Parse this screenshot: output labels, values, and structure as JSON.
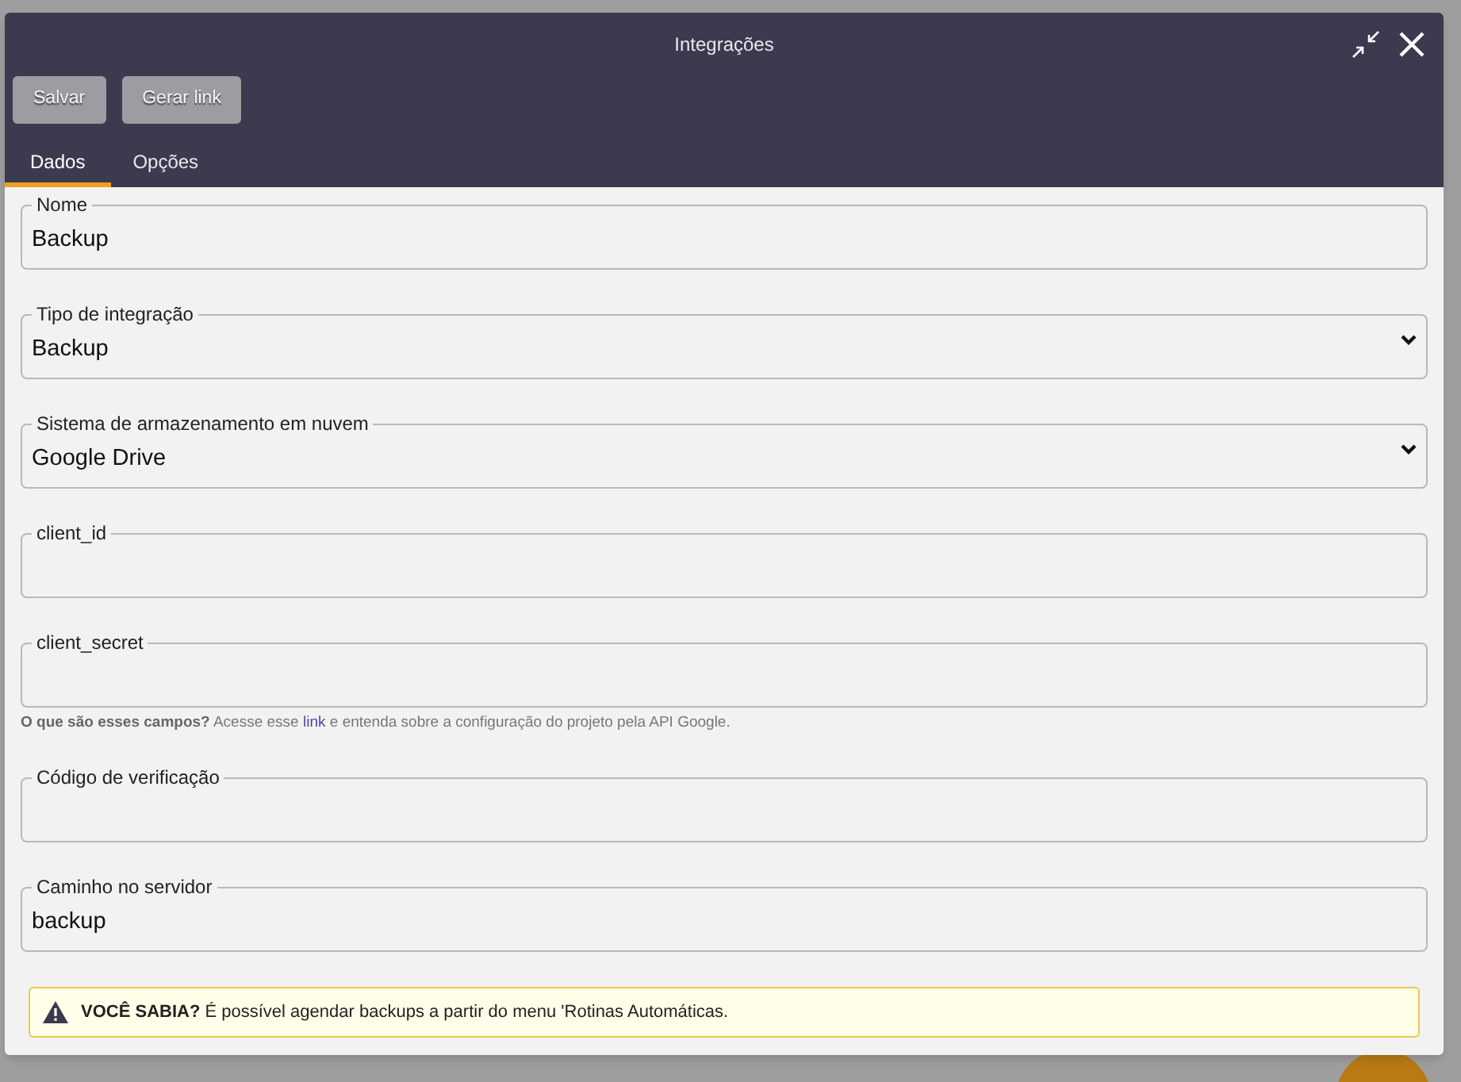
{
  "window": {
    "title": "Integrações"
  },
  "toolbar": {
    "buttons": [
      "Salvar",
      "Gerar link"
    ]
  },
  "tabs": [
    {
      "label": "Dados",
      "selected": true
    },
    {
      "label": "Opções",
      "selected": false
    }
  ],
  "fields": [
    {
      "kind": "text",
      "label": "Nome",
      "value": "Backup"
    },
    {
      "kind": "select",
      "label": "Tipo de integração",
      "value": "Backup"
    },
    {
      "kind": "select",
      "label": "Sistema de armazenamento em nuvem",
      "value": "Google Drive"
    },
    {
      "kind": "text",
      "label": "client_id"
    },
    {
      "kind": "text",
      "label": "client_secret",
      "help": {
        "lead": "O que são esses campos?",
        "before_link": "Acesse esse",
        "link": "link",
        "after_link": "e entenda sobre a configuração do projeto pela API Google."
      }
    },
    {
      "kind": "text",
      "label": "Código de verificação"
    },
    {
      "kind": "text",
      "label": "Caminho no servidor",
      "value": "backup"
    }
  ],
  "alert": {
    "text": "**VOCÊ SABIA?** É possível agendar backups a partir do menu 'Rotinas Automáticas."
  }
}
